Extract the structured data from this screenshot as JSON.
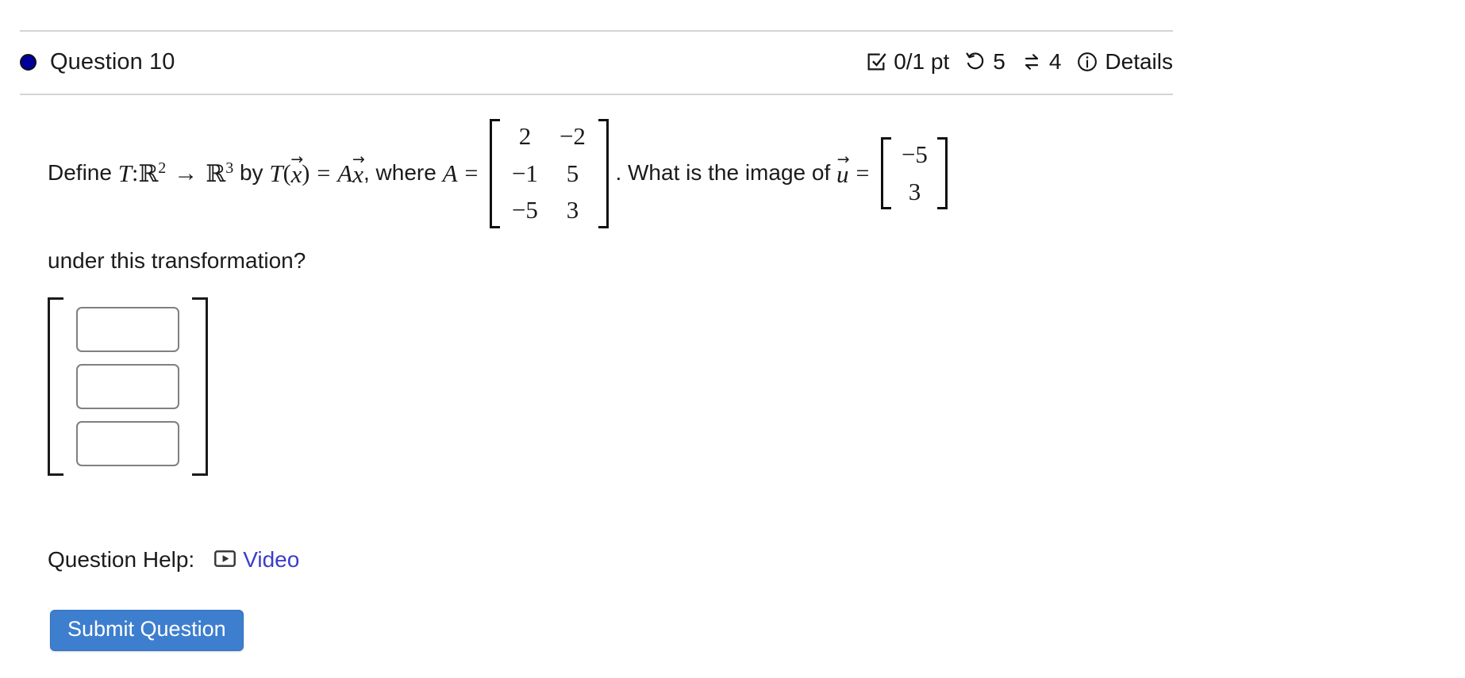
{
  "question": {
    "title": "Question 10",
    "bullet_color": "#00009c",
    "meta": {
      "score": "0/1 pt",
      "score_icon": "checkbox-check-icon",
      "attempts": "5",
      "attempts_icon": "undo-arrow-icon",
      "retries": "4",
      "retries_icon": "swap-arrows-icon",
      "details_label": "Details",
      "details_icon": "info-circle-icon"
    }
  },
  "statement": {
    "lead": "Define ",
    "T": "T",
    "colon": " : ",
    "R": "R",
    "exp_domain": "2",
    "arrow": "→",
    "exp_codomain": "3",
    "by": " by ",
    "Tfun": "T",
    "paren_open": "(",
    "x": "x",
    "paren_close": ")",
    "equals": "=",
    "A_times": "A",
    "x2": "x",
    "comma_where": ", where ",
    "A_label": "A",
    "equals2": "=",
    "period_what": ". What is the image of ",
    "u": "u",
    "equals3": "=",
    "line2": "under this transformation?"
  },
  "matrix_A": {
    "rows": [
      [
        "2",
        "−2"
      ],
      [
        "−1",
        "5"
      ],
      [
        "−5",
        "3"
      ]
    ]
  },
  "vector_u": {
    "rows": [
      [
        "−5"
      ],
      [
        "3"
      ]
    ]
  },
  "answer": {
    "inputs": [
      {
        "value": "",
        "placeholder": ""
      },
      {
        "value": "",
        "placeholder": ""
      },
      {
        "value": "",
        "placeholder": ""
      }
    ]
  },
  "help": {
    "label": "Question Help:",
    "video_label": "Video",
    "video_icon": "video-play-icon",
    "link_color": "#3c3ccb"
  },
  "submit": {
    "label": "Submit Question",
    "color": "#3d7ecf"
  }
}
